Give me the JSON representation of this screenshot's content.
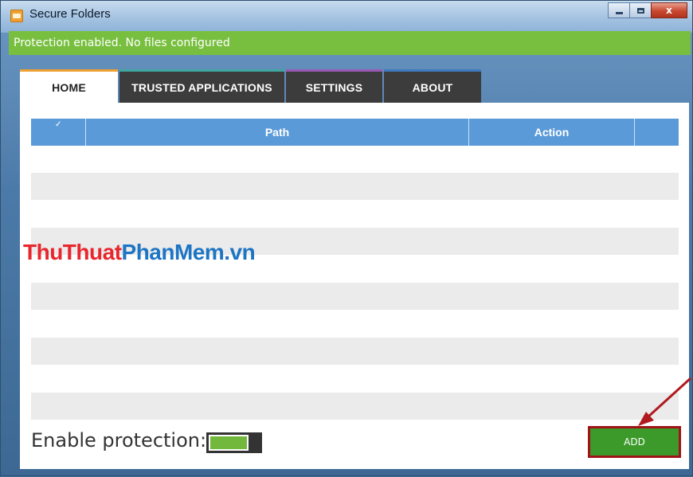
{
  "window": {
    "title": "Secure Folders",
    "controls": {
      "minimize": "—",
      "maximize": "□",
      "close": "x"
    }
  },
  "status": {
    "text": "Protection enabled. No files configured"
  },
  "tabs": [
    {
      "label": "HOME",
      "active": true
    },
    {
      "label": "TRUSTED APPLICATIONS",
      "active": false
    },
    {
      "label": "SETTINGS",
      "active": false
    },
    {
      "label": "ABOUT",
      "active": false
    }
  ],
  "table": {
    "columns": [
      "",
      "Path",
      "Action",
      ""
    ],
    "rows": []
  },
  "watermark": {
    "part1": "ThuThuat",
    "part2": "PhanMem.vn"
  },
  "protection": {
    "label": "Enable protection:",
    "enabled": true
  },
  "add_button": {
    "label": "ADD"
  },
  "colors": {
    "status_green": "#78bf3f",
    "header_blue": "#5b9ad8",
    "add_green": "#3c9a2a",
    "highlight_red": "#a01418"
  },
  "icons": {
    "app": "folder-lock-icon",
    "annotation": "red-arrow"
  }
}
